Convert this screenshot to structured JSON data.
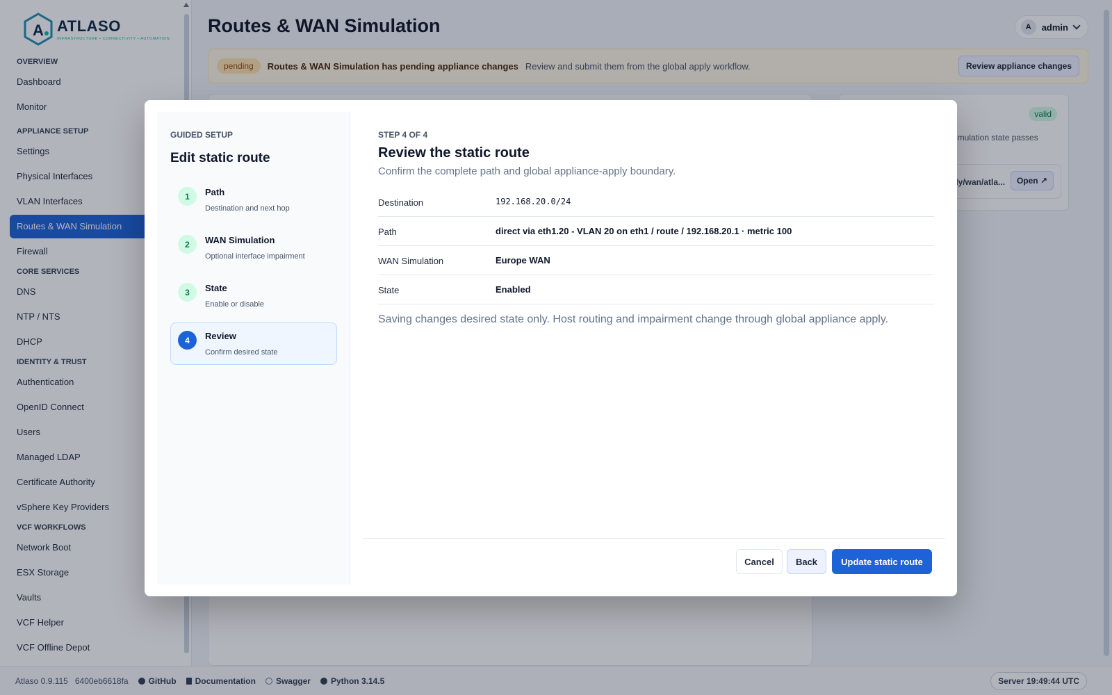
{
  "brand": {
    "name": "ATLASO",
    "tagline": "INFRASTRUCTURE • CONNECTIVITY • AUTOMATION"
  },
  "sidebar": {
    "sections": [
      {
        "title": "OVERVIEW",
        "items": [
          "Dashboard",
          "Monitor"
        ]
      },
      {
        "title": "APPLIANCE SETUP",
        "items": [
          "Settings",
          "Physical Interfaces",
          "VLAN Interfaces",
          "Routes & WAN Simulation",
          "Firewall"
        ]
      },
      {
        "title": "CORE SERVICES",
        "items": [
          "DNS",
          "NTP / NTS",
          "DHCP"
        ]
      },
      {
        "title": "IDENTITY & TRUST",
        "items": [
          "Authentication",
          "OpenID Connect",
          "Users",
          "Managed LDAP",
          "Certificate Authority",
          "vSphere Key Providers"
        ]
      },
      {
        "title": "VCF WORKFLOWS",
        "items": [
          "Network Boot",
          "ESX Storage",
          "Vaults",
          "VCF Helper",
          "VCF Offline Depot"
        ]
      }
    ],
    "active_item": "Routes & WAN Simulation"
  },
  "header": {
    "title": "Routes & WAN Simulation",
    "user_initial": "A",
    "user_name": "admin"
  },
  "banner": {
    "badge": "pending",
    "title": "Routes & WAN Simulation has pending appliance changes",
    "text": "Review and submit them from the global apply workflow.",
    "button": "Review appliance changes"
  },
  "right_card": {
    "badge": "valid",
    "text": "N simulation state passes",
    "path": "ply/wan/atla...",
    "open_button": "Open ↗"
  },
  "modal": {
    "eyebrow": "GUIDED SETUP",
    "title": "Edit static route",
    "steps": [
      {
        "num": "1",
        "name": "Path",
        "desc": "Destination and next hop"
      },
      {
        "num": "2",
        "name": "WAN Simulation",
        "desc": "Optional interface impairment"
      },
      {
        "num": "3",
        "name": "State",
        "desc": "Enable or disable"
      },
      {
        "num": "4",
        "name": "Review",
        "desc": "Confirm desired state"
      }
    ],
    "active_step": 4,
    "review": {
      "step_label": "STEP 4 OF 4",
      "title": "Review the static route",
      "subtitle": "Confirm the complete path and global appliance-apply boundary.",
      "rows": [
        {
          "label": "Destination",
          "value": "192.168.20.0/24"
        },
        {
          "label": "Path",
          "value": "direct via eth1.20 - VLAN 20 on eth1 / route / 192.168.20.1 · metric 100"
        },
        {
          "label": "WAN Simulation",
          "value": "Europe WAN"
        },
        {
          "label": "State",
          "value": "Enabled"
        }
      ],
      "note": "Saving changes desired state only. Host routing and impairment change through global appliance apply."
    },
    "buttons": {
      "cancel": "Cancel",
      "back": "Back",
      "primary": "Update static route"
    }
  },
  "footer": {
    "version": "Atlaso 0.9.115",
    "hash": "6400eb6618fa",
    "links": [
      "GitHub",
      "Documentation",
      "Swagger",
      "Python 3.14.5"
    ],
    "server_time": "Server 19:49:44 UTC"
  },
  "colors": {
    "accent": "#1d63d8",
    "pending_bg": "#fff7e6",
    "valid_badge": "#d1fae5"
  }
}
